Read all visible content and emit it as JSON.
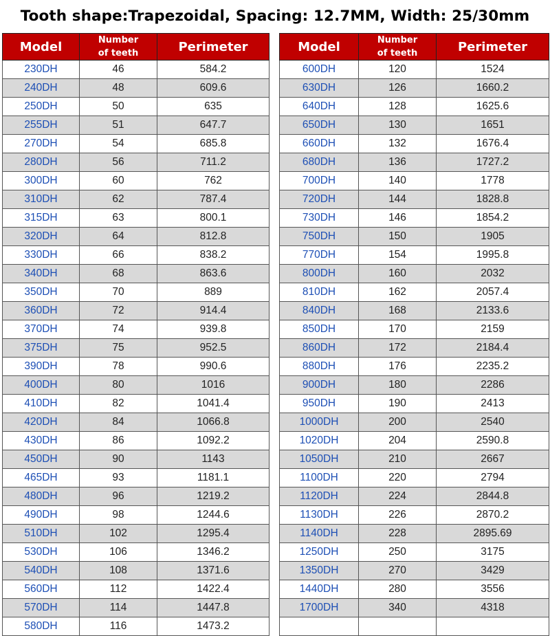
{
  "title": "Tooth shape:Trapezoidal, Spacing: 12.7MM, Width: 25/30mm",
  "headers": {
    "model": "Model",
    "teeth_line1": "Number",
    "teeth_line2": "of teeth",
    "perimeter": "Perimeter"
  },
  "left_rows": [
    [
      "230DH",
      "46",
      "584.2"
    ],
    [
      "240DH",
      "48",
      "609.6"
    ],
    [
      "250DH",
      "50",
      "635"
    ],
    [
      "255DH",
      "51",
      "647.7"
    ],
    [
      "270DH",
      "54",
      "685.8"
    ],
    [
      "280DH",
      "56",
      "711.2"
    ],
    [
      "300DH",
      "60",
      "762"
    ],
    [
      "310DH",
      "62",
      "787.4"
    ],
    [
      "315DH",
      "63",
      "800.1"
    ],
    [
      "320DH",
      "64",
      "812.8"
    ],
    [
      "330DH",
      "66",
      "838.2"
    ],
    [
      "340DH",
      "68",
      "863.6"
    ],
    [
      "350DH",
      "70",
      "889"
    ],
    [
      "360DH",
      "72",
      "914.4"
    ],
    [
      "370DH",
      "74",
      "939.8"
    ],
    [
      "375DH",
      "75",
      "952.5"
    ],
    [
      "390DH",
      "78",
      "990.6"
    ],
    [
      "400DH",
      "80",
      "1016"
    ],
    [
      "410DH",
      "82",
      "1041.4"
    ],
    [
      "420DH",
      "84",
      "1066.8"
    ],
    [
      "430DH",
      "86",
      "1092.2"
    ],
    [
      "450DH",
      "90",
      "1143"
    ],
    [
      "465DH",
      "93",
      "1181.1"
    ],
    [
      "480DH",
      "96",
      "1219.2"
    ],
    [
      "490DH",
      "98",
      "1244.6"
    ],
    [
      "510DH",
      "102",
      "1295.4"
    ],
    [
      "530DH",
      "106",
      "1346.2"
    ],
    [
      "540DH",
      "108",
      "1371.6"
    ],
    [
      "560DH",
      "112",
      "1422.4"
    ],
    [
      "570DH",
      "114",
      "1447.8"
    ],
    [
      "580DH",
      "116",
      "1473.2"
    ]
  ],
  "right_rows": [
    [
      "600DH",
      "120",
      "1524"
    ],
    [
      "630DH",
      "126",
      "1660.2"
    ],
    [
      "640DH",
      "128",
      "1625.6"
    ],
    [
      "650DH",
      "130",
      "1651"
    ],
    [
      "660DH",
      "132",
      "1676.4"
    ],
    [
      "680DH",
      "136",
      "1727.2"
    ],
    [
      "700DH",
      "140",
      "1778"
    ],
    [
      "720DH",
      "144",
      "1828.8"
    ],
    [
      "730DH",
      "146",
      "1854.2"
    ],
    [
      "750DH",
      "150",
      "1905"
    ],
    [
      "770DH",
      "154",
      "1995.8"
    ],
    [
      "800DH",
      "160",
      "2032"
    ],
    [
      "810DH",
      "162",
      "2057.4"
    ],
    [
      "840DH",
      "168",
      "2133.6"
    ],
    [
      "850DH",
      "170",
      "2159"
    ],
    [
      "860DH",
      "172",
      "2184.4"
    ],
    [
      "880DH",
      "176",
      "2235.2"
    ],
    [
      "900DH",
      "180",
      "2286"
    ],
    [
      "950DH",
      "190",
      "2413"
    ],
    [
      "1000DH",
      "200",
      "2540"
    ],
    [
      "1020DH",
      "204",
      "2590.8"
    ],
    [
      "1050DH",
      "210",
      "2667"
    ],
    [
      "1100DH",
      "220",
      "2794"
    ],
    [
      "1120DH",
      "224",
      "2844.8"
    ],
    [
      "1130DH",
      "226",
      "2870.2"
    ],
    [
      "1140DH",
      "228",
      "2895.69"
    ],
    [
      "1250DH",
      "250",
      "3175"
    ],
    [
      "1350DH",
      "270",
      "3429"
    ],
    [
      "1440DH",
      "280",
      "3556"
    ],
    [
      "1700DH",
      "340",
      "4318"
    ],
    [
      "",
      "",
      ""
    ]
  ],
  "colors": {
    "header_bg": "#c00000",
    "header_text": "#ffffff",
    "model_text": "#1d4fb5",
    "alt_row_bg": "#d9d9d9"
  }
}
